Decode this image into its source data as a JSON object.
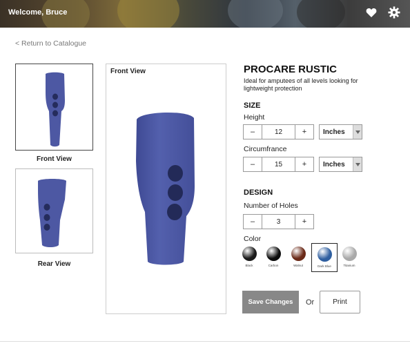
{
  "header": {
    "welcome": "Welcome, Bruce",
    "icons": [
      "heart-icon",
      "gear-icon"
    ]
  },
  "nav": {
    "return_link": "< Return to Catalogue"
  },
  "thumbnails": {
    "front_label": "Front View",
    "rear_label": "Rear View"
  },
  "main_view": {
    "title": "Front View"
  },
  "product": {
    "name": "PROCARE RUSTIC",
    "description": "Ideal for amputees of all levels looking for lightweight protection",
    "color_hex": "#4d58a3"
  },
  "size": {
    "section_title": "SIZE",
    "height_label": "Height",
    "height_value": "12",
    "height_unit": "Inches",
    "circumference_label": "Circumfrance",
    "circumference_value": "15",
    "circumference_unit": "Inches"
  },
  "design": {
    "section_title": "DESIGN",
    "holes_label": "Number of Holes",
    "holes_value": "3",
    "color_label": "Color",
    "colors": [
      {
        "name": "Black",
        "hex": "#1a1a1a"
      },
      {
        "name": "Carbon",
        "hex": "#0d0d0d"
      },
      {
        "name": "Walnut",
        "hex": "#6b2a18"
      },
      {
        "name": "Dark Blue",
        "hex": "#2f5fa0"
      },
      {
        "name": "Titanium",
        "hex": "#a9a9a9"
      }
    ],
    "selected_color": "Dark Blue"
  },
  "stepper": {
    "minus": "–",
    "plus": "+"
  },
  "actions": {
    "save_label": "Save Changes",
    "or_label": "Or",
    "print_label": "Print"
  }
}
